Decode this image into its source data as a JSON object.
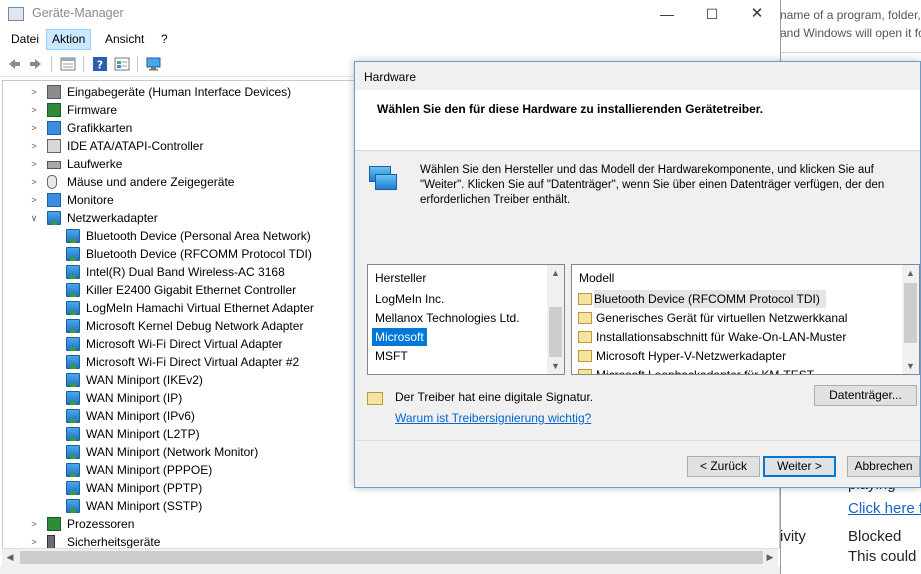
{
  "background_page": {
    "line1": "name of a program, folder,",
    "line2": "and Windows will open it fo",
    "text_playing": "playing",
    "link_click_here": "Click here f",
    "text_ivity": "ivity",
    "text_blocked": "Blocked",
    "text_this_could": "This could"
  },
  "device_manager": {
    "title": "Geräte-Manager",
    "window_buttons": {
      "minimize": "—",
      "maximize": "☐",
      "close": "✕"
    },
    "menu": [
      "Datei",
      "Aktion",
      "Ansicht",
      "?"
    ],
    "active_menu": "Aktion",
    "tree": [
      {
        "label": "Eingabegeräte (Human Interface Devices)",
        "icon": "hid-icon",
        "expand": "collapsed",
        "level": 0
      },
      {
        "label": "Firmware",
        "icon": "firmware-icon",
        "expand": "collapsed",
        "level": 0
      },
      {
        "label": "Grafikkarten",
        "icon": "display-adapter-icon",
        "expand": "collapsed",
        "level": 0
      },
      {
        "label": "IDE ATA/ATAPI-Controller",
        "icon": "ide-controller-icon",
        "expand": "collapsed",
        "level": 0
      },
      {
        "label": "Laufwerke",
        "icon": "disk-drive-icon",
        "expand": "collapsed",
        "level": 0
      },
      {
        "label": "Mäuse und andere Zeigegeräte",
        "icon": "mouse-icon",
        "expand": "collapsed",
        "level": 0
      },
      {
        "label": "Monitore",
        "icon": "monitor-icon",
        "expand": "collapsed",
        "level": 0
      },
      {
        "label": "Netzwerkadapter",
        "icon": "network-adapter-icon",
        "expand": "expanded",
        "level": 0
      },
      {
        "label": "Bluetooth Device (Personal Area Network)",
        "icon": "network-adapter-icon",
        "expand": "none",
        "level": 1
      },
      {
        "label": "Bluetooth Device (RFCOMM Protocol TDI)",
        "icon": "network-adapter-icon",
        "expand": "none",
        "level": 1
      },
      {
        "label": "Intel(R) Dual Band Wireless-AC 3168",
        "icon": "network-adapter-icon",
        "expand": "none",
        "level": 1
      },
      {
        "label": "Killer E2400 Gigabit Ethernet Controller",
        "icon": "network-adapter-icon",
        "expand": "none",
        "level": 1
      },
      {
        "label": "LogMeIn Hamachi Virtual Ethernet Adapter",
        "icon": "network-adapter-icon",
        "expand": "none",
        "level": 1
      },
      {
        "label": "Microsoft Kernel Debug Network Adapter",
        "icon": "network-adapter-icon",
        "expand": "none",
        "level": 1
      },
      {
        "label": "Microsoft Wi-Fi Direct Virtual Adapter",
        "icon": "network-adapter-icon",
        "expand": "none",
        "level": 1
      },
      {
        "label": "Microsoft Wi-Fi Direct Virtual Adapter #2",
        "icon": "network-adapter-icon",
        "expand": "none",
        "level": 1
      },
      {
        "label": "WAN Miniport (IKEv2)",
        "icon": "network-adapter-icon",
        "expand": "none",
        "level": 1
      },
      {
        "label": "WAN Miniport (IP)",
        "icon": "network-adapter-icon",
        "expand": "none",
        "level": 1
      },
      {
        "label": "WAN Miniport (IPv6)",
        "icon": "network-adapter-icon",
        "expand": "none",
        "level": 1
      },
      {
        "label": "WAN Miniport (L2TP)",
        "icon": "network-adapter-icon",
        "expand": "none",
        "level": 1
      },
      {
        "label": "WAN Miniport (Network Monitor)",
        "icon": "network-adapter-icon",
        "expand": "none",
        "level": 1
      },
      {
        "label": "WAN Miniport (PPPOE)",
        "icon": "network-adapter-icon",
        "expand": "none",
        "level": 1
      },
      {
        "label": "WAN Miniport (PPTP)",
        "icon": "network-adapter-icon",
        "expand": "none",
        "level": 1
      },
      {
        "label": "WAN Miniport (SSTP)",
        "icon": "network-adapter-icon",
        "expand": "none",
        "level": 1
      },
      {
        "label": "Prozessoren",
        "icon": "processor-icon",
        "expand": "collapsed",
        "level": 0
      },
      {
        "label": "Sicherheitsgeräte",
        "icon": "security-device-icon",
        "expand": "collapsed",
        "level": 0
      }
    ]
  },
  "dialog": {
    "title": "Hardware",
    "heading": "Wählen Sie den für diese Hardware zu installierenden Gerätetreiber.",
    "description": "Wählen Sie den Hersteller und das Modell der Hardwarekomponente, und klicken Sie auf \"Weiter\". Klicken Sie auf \"Datenträger\", wenn Sie über einen Datenträger verfügen, der den erforderlichen Treiber enthält.",
    "manufacturer": {
      "header": "Hersteller",
      "items": [
        "LogMeIn Inc.",
        "Mellanox Technologies Ltd.",
        "Microsoft",
        "MSFT"
      ],
      "selected": "Microsoft"
    },
    "model": {
      "header": "Modell",
      "items": [
        "Bluetooth Device (RFCOMM Protocol TDI)",
        "Generisches Gerät für virtuellen Netzwerkkanal",
        "Installationsabschnitt für Wake-On-LAN-Muster",
        "Microsoft Hyper-V-Netzwerkadapter",
        "Microsoft Loopbackadapter für KM-TEST"
      ],
      "selected": "Bluetooth Device (RFCOMM Protocol TDI)"
    },
    "signature_text": "Der Treiber hat eine digitale Signatur.",
    "signature_link": "Warum ist Treibersignierung wichtig?",
    "btn_disk": "Datenträger...",
    "btn_back": "< Zurück",
    "btn_next": "Weiter >",
    "btn_cancel": "Abbrechen"
  },
  "colors": {
    "selection": "#0078d7",
    "link": "#0066cc",
    "menu_active": "#cce8ff"
  }
}
